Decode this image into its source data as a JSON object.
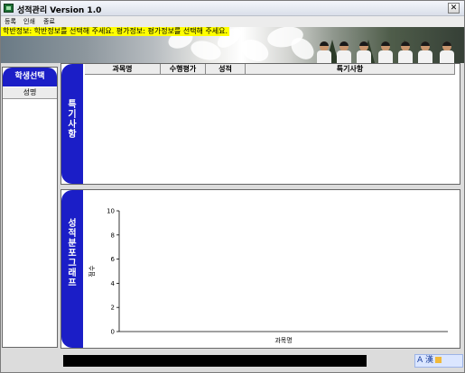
{
  "window": {
    "title": "성적관리 Version 1.0",
    "close_glyph": "✕"
  },
  "menu": [
    "등록",
    "인쇄",
    "종료"
  ],
  "info_bar": {
    "text": "학반정보: 학반정보를 선택해 주세요.   평가정보: 평가정보를 선택해 주세요."
  },
  "sidebar": {
    "tab_label": "학생선택",
    "column_header": "성명"
  },
  "special_panel": {
    "tab_label": "특기사항",
    "columns": [
      "과목명",
      "수행평가",
      "성적",
      "특기사항"
    ]
  },
  "chart_panel": {
    "tab_label": "성적분포 그래프"
  },
  "chart_data": {
    "type": "bar",
    "categories": [],
    "values": [],
    "xlabel": "과목명",
    "ylabel": "점수",
    "ylim": [
      0,
      10
    ],
    "ticks": [
      0,
      2,
      4,
      6,
      8,
      10
    ]
  },
  "status": {
    "ime_text": "A 漢"
  },
  "colors": {
    "accent": "#1b1ec7",
    "info": "#ffff00"
  }
}
